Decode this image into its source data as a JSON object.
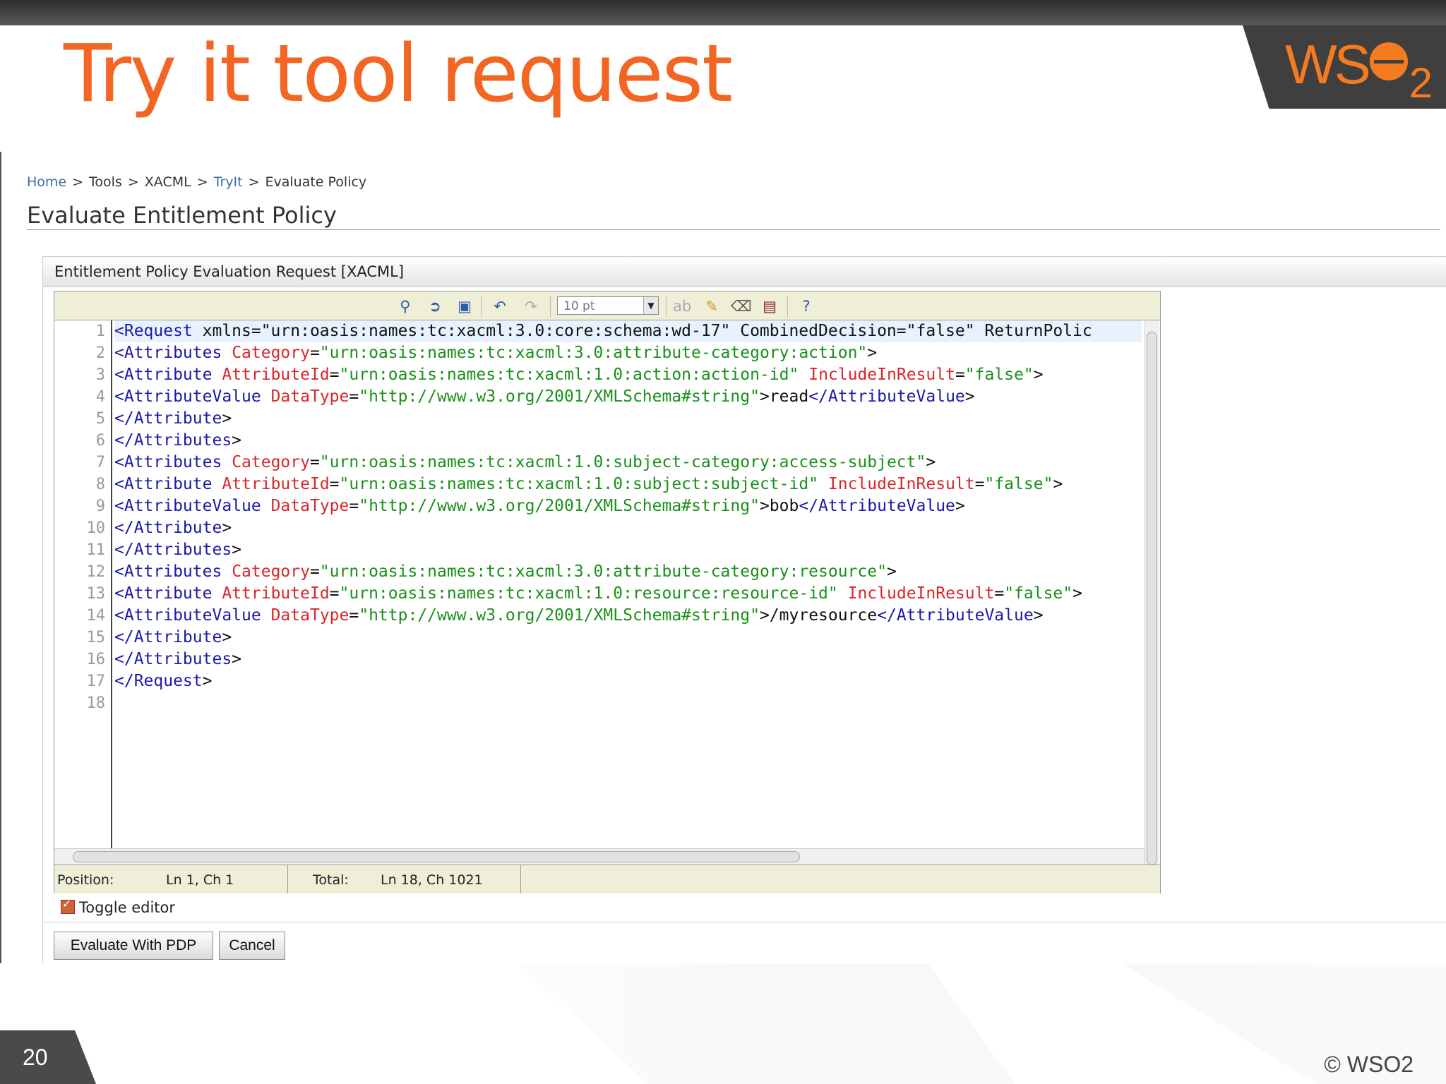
{
  "slide": {
    "title": "Try it tool request",
    "logo_text": "WS",
    "logo_suffix": "2",
    "slide_number": "20",
    "copyright": "© WSO2"
  },
  "breadcrumb": [
    {
      "label": "Home",
      "link": true
    },
    {
      "label": "Tools",
      "link": false
    },
    {
      "label": "XACML",
      "link": false
    },
    {
      "label": "TryIt",
      "link": true
    },
    {
      "label": "Evaluate Policy",
      "link": false
    }
  ],
  "breadcrumb_separator": ">",
  "page": {
    "heading": "Evaluate Entitlement Policy",
    "panel_title": "Entitlement Policy Evaluation Request [XACML]"
  },
  "toolbar": {
    "icons": [
      "find-icon",
      "goto-icon",
      "fullscreen-icon",
      "undo-icon",
      "redo-icon",
      "font-size-select",
      "spellcheck-icon",
      "highlight-icon",
      "reset-icon",
      "word-wrap-icon",
      "help-icon"
    ],
    "font_size": "10 pt"
  },
  "editor": {
    "line_numbers": [
      "1",
      "2",
      "3",
      "4",
      "5",
      "6",
      "7",
      "8",
      "9",
      "10",
      "11",
      "12",
      "13",
      "14",
      "15",
      "16",
      "17",
      "18"
    ],
    "status": {
      "position_label": "Position:",
      "position_value": "Ln 1, Ch 1",
      "total_label": "Total:",
      "total_value": "Ln 18, Ch 1021"
    }
  },
  "toggle_editor": {
    "label": "Toggle editor",
    "checked": true
  },
  "buttons": {
    "evaluate": "Evaluate With PDP",
    "cancel": "Cancel"
  },
  "colors": {
    "title_orange": "#f26522",
    "xml_tag": "#1a1aa6",
    "xml_attr_name": "#d9262b",
    "xml_attr_value": "#199019",
    "toolbar_bg": "#efefd8"
  }
}
